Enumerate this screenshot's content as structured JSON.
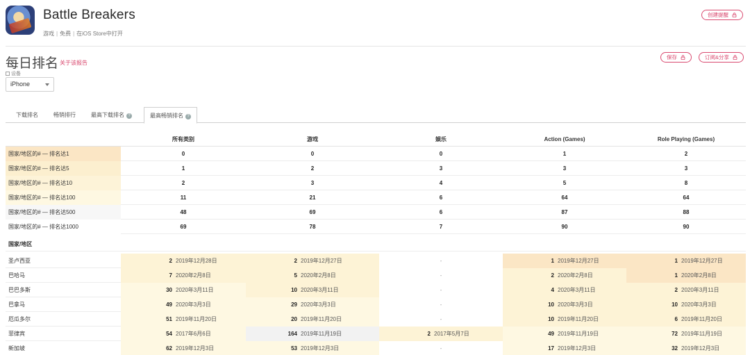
{
  "header": {
    "app_name": "Battle Breakers",
    "category": "游戏",
    "price": "免费",
    "store_link": "在iOS Store中打开",
    "create_alert_label": "创建提醒"
  },
  "page": {
    "title": "每日排名",
    "about_report": "关于该报告",
    "save_label": "保存",
    "subscribe_share_label": "订阅&分享",
    "device_label": "设备",
    "device_value": "iPhone"
  },
  "tabs": [
    {
      "label": "下载排名"
    },
    {
      "label": "畅销排行"
    },
    {
      "label": "最高下载排名"
    },
    {
      "label": "最高畅销排名"
    }
  ],
  "table": {
    "columns": [
      "所有类别",
      "游戏",
      "娱乐",
      "Action (Games)",
      "Role Playing (Games)"
    ],
    "summary_rows": [
      {
        "label": "国家/地区的# — 排名达1",
        "values": [
          "0",
          "0",
          "0",
          "1",
          "2"
        ],
        "color": "#fbe6c5"
      },
      {
        "label": "国家/地区的# — 排名达5",
        "values": [
          "1",
          "2",
          "3",
          "3",
          "3"
        ],
        "color": "#fcefcf"
      },
      {
        "label": "国家/地区的# — 排名达10",
        "values": [
          "2",
          "3",
          "4",
          "5",
          "8"
        ],
        "color": "#fdf3d8"
      },
      {
        "label": "国家/地区的# — 排名达100",
        "values": [
          "11",
          "21",
          "6",
          "64",
          "64"
        ],
        "color": "#fef8e2"
      },
      {
        "label": "国家/地区的# — 排名达500",
        "values": [
          "48",
          "69",
          "6",
          "87",
          "88"
        ],
        "color": "#f7f7f7"
      },
      {
        "label": "国家/地区的# — 排名达1000",
        "values": [
          "69",
          "78",
          "7",
          "90",
          "90"
        ],
        "color": "#ffffff"
      }
    ],
    "country_header": "国家/地区",
    "country_rows": [
      {
        "name": "圣卢西亚",
        "cells": [
          {
            "rank": "2",
            "date": "2019年12月28日",
            "bg": "#fdf3d6"
          },
          {
            "rank": "2",
            "date": "2019年12月27日",
            "bg": "#fdf3d6"
          },
          {
            "dash": "-",
            "bg": "#ffffff"
          },
          {
            "rank": "1",
            "date": "2019年12月27日",
            "bg": "#fbe6c5"
          },
          {
            "rank": "1",
            "date": "2019年12月27日",
            "bg": "#fbe6c5"
          }
        ]
      },
      {
        "name": "巴哈马",
        "cells": [
          {
            "rank": "7",
            "date": "2020年2月8日",
            "bg": "#fdf3d6"
          },
          {
            "rank": "5",
            "date": "2020年2月8日",
            "bg": "#fdf3d6"
          },
          {
            "dash": "-",
            "bg": "#ffffff"
          },
          {
            "rank": "2",
            "date": "2020年2月8日",
            "bg": "#fdf3d6"
          },
          {
            "rank": "1",
            "date": "2020年2月8日",
            "bg": "#fbe6c5"
          }
        ]
      },
      {
        "name": "巴巴多斯",
        "cells": [
          {
            "rank": "30",
            "date": "2020年3月11日",
            "bg": "#fef8e2"
          },
          {
            "rank": "10",
            "date": "2020年3月11日",
            "bg": "#fdf3d6"
          },
          {
            "dash": "-",
            "bg": "#ffffff"
          },
          {
            "rank": "4",
            "date": "2020年3月11日",
            "bg": "#fdf3d6"
          },
          {
            "rank": "2",
            "date": "2020年3月11日",
            "bg": "#fdf3d6"
          }
        ]
      },
      {
        "name": "巴拿马",
        "cells": [
          {
            "rank": "49",
            "date": "2020年3月3日",
            "bg": "#fef8e2"
          },
          {
            "rank": "29",
            "date": "2020年3月3日",
            "bg": "#fef8e2"
          },
          {
            "dash": "-",
            "bg": "#ffffff"
          },
          {
            "rank": "10",
            "date": "2020年3月3日",
            "bg": "#fdf3d6"
          },
          {
            "rank": "10",
            "date": "2020年3月3日",
            "bg": "#fdf3d6"
          }
        ]
      },
      {
        "name": "厄瓜多尔",
        "cells": [
          {
            "rank": "51",
            "date": "2019年11月20日",
            "bg": "#fef8e2"
          },
          {
            "rank": "20",
            "date": "2019年11月20日",
            "bg": "#fef8e2"
          },
          {
            "dash": "-",
            "bg": "#ffffff"
          },
          {
            "rank": "10",
            "date": "2019年11月20日",
            "bg": "#fdf3d6"
          },
          {
            "rank": "6",
            "date": "2019年11月20日",
            "bg": "#fdf3d6"
          }
        ]
      },
      {
        "name": "菲律宾",
        "cells": [
          {
            "rank": "54",
            "date": "2017年6月6日",
            "bg": "#fef8e2"
          },
          {
            "rank": "164",
            "date": "2019年11月19日",
            "bg": "#f2f2f2"
          },
          {
            "rank": "2",
            "date": "2017年5月7日",
            "bg": "#fdf3d6"
          },
          {
            "rank": "49",
            "date": "2019年11月19日",
            "bg": "#fef8e2"
          },
          {
            "rank": "72",
            "date": "2019年11月19日",
            "bg": "#fef8e2"
          }
        ]
      },
      {
        "name": "新加坡",
        "cells": [
          {
            "rank": "62",
            "date": "2019年12月3日",
            "bg": "#fef8e2"
          },
          {
            "rank": "53",
            "date": "2019年12月3日",
            "bg": "#fef8e2"
          },
          {
            "dash": "-",
            "bg": "#ffffff"
          },
          {
            "rank": "17",
            "date": "2019年12月3日",
            "bg": "#fef8e2"
          },
          {
            "rank": "32",
            "date": "2019年12月3日",
            "bg": "#fef8e2"
          }
        ]
      }
    ]
  },
  "colors": {
    "accent": "#d9486e",
    "border": "#e5e5e5"
  },
  "icons": {
    "lock": "lock-icon",
    "help": "question-circle-icon",
    "device": "device-icon",
    "dropdown": "chevron-down-icon"
  }
}
